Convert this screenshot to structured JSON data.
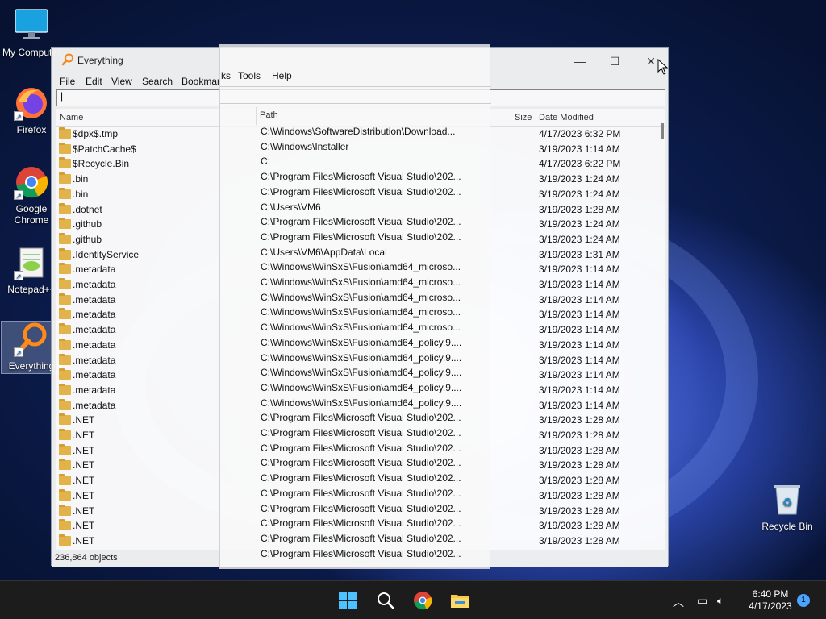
{
  "desktop": {
    "icons": [
      {
        "label": "My Computer",
        "glyph": "monitor-icon"
      },
      {
        "label": "Firefox",
        "glyph": "firefox-icon"
      },
      {
        "label": "Google Chrome",
        "glyph": "chrome-icon"
      },
      {
        "label": "Notepad++",
        "glyph": "notepadpp-icon"
      },
      {
        "label": "Everything",
        "glyph": "everything-icon"
      }
    ],
    "recycle_bin": "Recycle Bin"
  },
  "window": {
    "title": "Everything",
    "controls": {
      "minimize": "—",
      "maximize": "☐",
      "close": "✕"
    },
    "menu": [
      "File",
      "Edit",
      "View",
      "Search",
      "Bookmarks",
      "Tools",
      "Help"
    ],
    "menu_visible_left": [
      "File",
      "Edit",
      "View",
      "Search",
      "Bookmar"
    ],
    "menu_visible_right": [
      "ks",
      "Tools",
      "Help"
    ],
    "search_value": "",
    "columns": {
      "name": "Name",
      "path": "Path",
      "size": "Size",
      "date": "Date Modified"
    },
    "rows": [
      {
        "name": "$dpx$.tmp",
        "path": "C:\\Windows\\SoftwareDistribution\\Download...",
        "date": "4/17/2023 6:32 PM"
      },
      {
        "name": "$PatchCache$",
        "path": "C:\\Windows\\Installer",
        "date": "3/19/2023 1:14 AM"
      },
      {
        "name": "$Recycle.Bin",
        "path": "C:",
        "date": "4/17/2023 6:22 PM"
      },
      {
        "name": ".bin",
        "path": "C:\\Program Files\\Microsoft Visual Studio\\202...",
        "date": "3/19/2023 1:24 AM"
      },
      {
        "name": ".bin",
        "path": "C:\\Program Files\\Microsoft Visual Studio\\202...",
        "date": "3/19/2023 1:24 AM"
      },
      {
        "name": ".dotnet",
        "path": "C:\\Users\\VM6",
        "date": "3/19/2023 1:28 AM"
      },
      {
        "name": ".github",
        "path": "C:\\Program Files\\Microsoft Visual Studio\\202...",
        "date": "3/19/2023 1:24 AM"
      },
      {
        "name": ".github",
        "path": "C:\\Program Files\\Microsoft Visual Studio\\202...",
        "date": "3/19/2023 1:24 AM"
      },
      {
        "name": ".IdentityService",
        "path": "C:\\Users\\VM6\\AppData\\Local",
        "date": "3/19/2023 1:31 AM"
      },
      {
        "name": ".metadata",
        "path": "C:\\Windows\\WinSxS\\Fusion\\amd64_microso...",
        "date": "3/19/2023 1:14 AM"
      },
      {
        "name": ".metadata",
        "path": "C:\\Windows\\WinSxS\\Fusion\\amd64_microso...",
        "date": "3/19/2023 1:14 AM"
      },
      {
        "name": ".metadata",
        "path": "C:\\Windows\\WinSxS\\Fusion\\amd64_microso...",
        "date": "3/19/2023 1:14 AM"
      },
      {
        "name": ".metadata",
        "path": "C:\\Windows\\WinSxS\\Fusion\\amd64_microso...",
        "date": "3/19/2023 1:14 AM"
      },
      {
        "name": ".metadata",
        "path": "C:\\Windows\\WinSxS\\Fusion\\amd64_microso...",
        "date": "3/19/2023 1:14 AM"
      },
      {
        "name": ".metadata",
        "path": "C:\\Windows\\WinSxS\\Fusion\\amd64_policy.9....",
        "date": "3/19/2023 1:14 AM"
      },
      {
        "name": ".metadata",
        "path": "C:\\Windows\\WinSxS\\Fusion\\amd64_policy.9....",
        "date": "3/19/2023 1:14 AM"
      },
      {
        "name": ".metadata",
        "path": "C:\\Windows\\WinSxS\\Fusion\\amd64_policy.9....",
        "date": "3/19/2023 1:14 AM"
      },
      {
        "name": ".metadata",
        "path": "C:\\Windows\\WinSxS\\Fusion\\amd64_policy.9....",
        "date": "3/19/2023 1:14 AM"
      },
      {
        "name": ".metadata",
        "path": "C:\\Windows\\WinSxS\\Fusion\\amd64_policy.9....",
        "date": "3/19/2023 1:14 AM"
      },
      {
        "name": ".NET",
        "path": "C:\\Program Files\\Microsoft Visual Studio\\202...",
        "date": "3/19/2023 1:28 AM"
      },
      {
        "name": ".NET",
        "path": "C:\\Program Files\\Microsoft Visual Studio\\202...",
        "date": "3/19/2023 1:28 AM"
      },
      {
        "name": ".NET",
        "path": "C:\\Program Files\\Microsoft Visual Studio\\202...",
        "date": "3/19/2023 1:28 AM"
      },
      {
        "name": ".NET",
        "path": "C:\\Program Files\\Microsoft Visual Studio\\202...",
        "date": "3/19/2023 1:28 AM"
      },
      {
        "name": ".NET",
        "path": "C:\\Program Files\\Microsoft Visual Studio\\202...",
        "date": "3/19/2023 1:28 AM"
      },
      {
        "name": ".NET",
        "path": "C:\\Program Files\\Microsoft Visual Studio\\202...",
        "date": "3/19/2023 1:28 AM"
      },
      {
        "name": ".NET",
        "path": "C:\\Program Files\\Microsoft Visual Studio\\202...",
        "date": "3/19/2023 1:28 AM"
      },
      {
        "name": ".NET",
        "path": "C:\\Program Files\\Microsoft Visual Studio\\202...",
        "date": "3/19/2023 1:28 AM"
      },
      {
        "name": ".NET",
        "path": "C:\\Program Files\\Microsoft Visual Studio\\202...",
        "date": "3/19/2023 1:28 AM"
      },
      {
        "name": ".NET",
        "path": "C:\\Program Files\\Microsoft Visual Studio\\202...",
        "date": "3/19/2023 1:28 AM"
      }
    ],
    "status": "236,864 objects"
  },
  "taskbar": {
    "icons": [
      "windows-start-icon",
      "search-icon",
      "chrome-icon",
      "file-explorer-icon"
    ],
    "time": "6:40 PM",
    "date": "4/17/2023",
    "notification_count": "1"
  },
  "colors": {
    "accent": "#0078d4",
    "folder": "#e8b84a",
    "taskbar": "#1c1c1c"
  }
}
